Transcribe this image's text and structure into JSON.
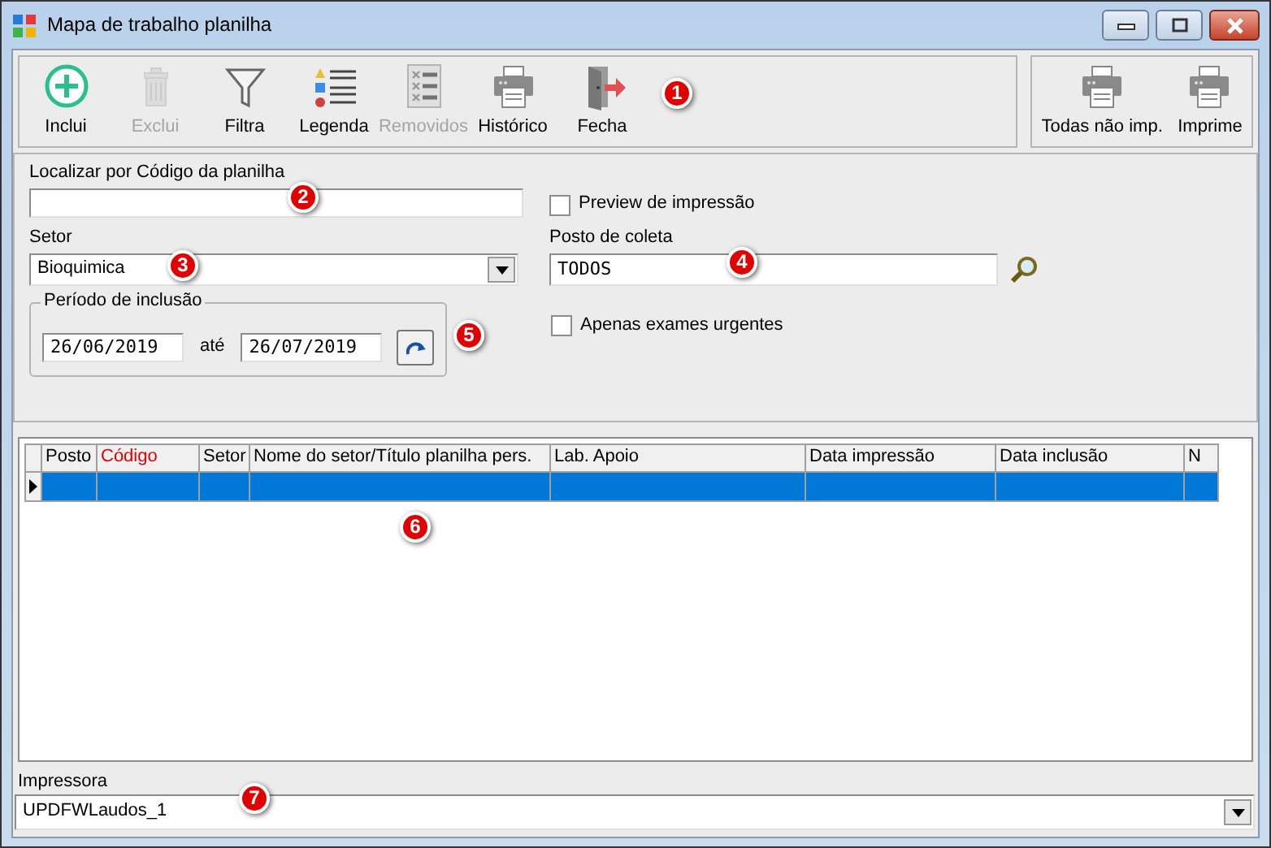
{
  "window": {
    "title": "Mapa de trabalho planilha"
  },
  "toolbar": [
    {
      "label": "Inclui",
      "disabled": false
    },
    {
      "label": "Exclui",
      "disabled": true
    },
    {
      "label": "Filtra",
      "disabled": false
    },
    {
      "label": "Legenda",
      "disabled": false
    },
    {
      "label": "Removidos",
      "disabled": true
    },
    {
      "label": "Histórico",
      "disabled": false
    },
    {
      "label": "Fecha",
      "disabled": false
    }
  ],
  "print_toolbar": [
    {
      "label": "Todas não imp."
    },
    {
      "label": "Imprime"
    }
  ],
  "search": {
    "label": "Localizar por Código da planilha"
  },
  "preview": {
    "label": "Preview de impressão",
    "checked": false
  },
  "setor": {
    "label": "Setor",
    "value": "Bioquimica"
  },
  "posto": {
    "label": "Posto de coleta",
    "value": "TODOS"
  },
  "period": {
    "label": "Período de inclusão",
    "from": "26/06/2019",
    "separator": "até",
    "to": "26/07/2019"
  },
  "urgent": {
    "label": "Apenas exames urgentes",
    "checked": false
  },
  "table": {
    "columns": [
      {
        "label": "Posto",
        "highlight": false
      },
      {
        "label": "Código",
        "highlight": true
      },
      {
        "label": "Setor",
        "highlight": false
      },
      {
        "label": "Nome do setor/Título planilha pers.",
        "highlight": false
      },
      {
        "label": "Lab. Apoio",
        "highlight": false
      },
      {
        "label": "Data impressão",
        "highlight": false
      },
      {
        "label": "Data inclusão",
        "highlight": false
      },
      {
        "label": "N",
        "highlight": false
      }
    ],
    "rows": [
      {
        "selected": true
      }
    ]
  },
  "printer": {
    "label": "Impressora",
    "value": "UPDFWLaudos_1"
  },
  "callouts": [
    "1",
    "2",
    "3",
    "4",
    "5",
    "6",
    "7"
  ]
}
